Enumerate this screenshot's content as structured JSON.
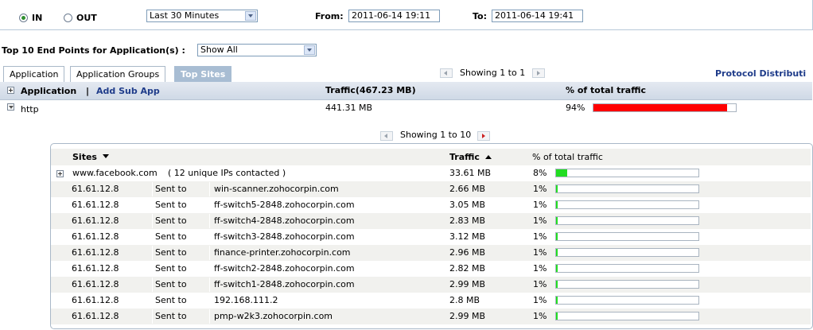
{
  "direction": {
    "in_label": "IN",
    "out_label": "OUT",
    "selected": "IN"
  },
  "range_select": "Last 30 Minutes",
  "from_label": "From:",
  "from_value": "2011-06-14 19:11",
  "to_label": "To:",
  "to_value": "2011-06-14 19:41",
  "endpoints_label": "Top 10 End Points for Application(s) :",
  "endpoints_select": "Show All",
  "tabs": [
    {
      "label": "Application",
      "active": false
    },
    {
      "label": "Application Groups",
      "active": false
    },
    {
      "label": "Top Sites",
      "active": true
    }
  ],
  "top_pager": "Showing 1 to 1",
  "protocol_link": "Protocol Distributi",
  "header": {
    "application": "Application",
    "separator": "|",
    "add_sub_app": "Add Sub App",
    "traffic": "Traffic(467.23 MB)",
    "percent": "% of total traffic"
  },
  "app_row": {
    "name": "http",
    "traffic": "441.31 MB",
    "percent_label": "94%",
    "percent": 94,
    "bar_color": "#ff0000"
  },
  "inner_pager": "Showing 1 to 10",
  "inner_header": {
    "sites": "Sites",
    "traffic": "Traffic",
    "percent": "% of total traffic"
  },
  "site": {
    "name": "www.facebook.com",
    "note": "( 12 unique IPs contacted )",
    "traffic": "33.61 MB",
    "percent_label": "8%",
    "percent": 8,
    "bar_color": "#22dd22"
  },
  "rows": [
    {
      "ip": "61.61.12.8",
      "action": "Sent to",
      "host": "win-scanner.zohocorpin.com",
      "traffic": "2.66 MB",
      "percent_label": "1%",
      "percent": 1
    },
    {
      "ip": "61.61.12.8",
      "action": "Sent to",
      "host": "ff-switch5-2848.zohocorpin.com",
      "traffic": "3.05 MB",
      "percent_label": "1%",
      "percent": 1
    },
    {
      "ip": "61.61.12.8",
      "action": "Sent to",
      "host": "ff-switch4-2848.zohocorpin.com",
      "traffic": "2.83 MB",
      "percent_label": "1%",
      "percent": 1
    },
    {
      "ip": "61.61.12.8",
      "action": "Sent to",
      "host": "ff-switch3-2848.zohocorpin.com",
      "traffic": "3.12 MB",
      "percent_label": "1%",
      "percent": 1
    },
    {
      "ip": "61.61.12.8",
      "action": "Sent to",
      "host": "finance-printer.zohocorpin.com",
      "traffic": "2.96 MB",
      "percent_label": "1%",
      "percent": 1
    },
    {
      "ip": "61.61.12.8",
      "action": "Sent to",
      "host": "ff-switch2-2848.zohocorpin.com",
      "traffic": "2.82 MB",
      "percent_label": "1%",
      "percent": 1
    },
    {
      "ip": "61.61.12.8",
      "action": "Sent to",
      "host": "ff-switch1-2848.zohocorpin.com",
      "traffic": "2.99 MB",
      "percent_label": "1%",
      "percent": 1
    },
    {
      "ip": "61.61.12.8",
      "action": "Sent to",
      "host": "192.168.111.2",
      "traffic": "2.8 MB",
      "percent_label": "1%",
      "percent": 1
    },
    {
      "ip": "61.61.12.8",
      "action": "Sent to",
      "host": "pmp-w2k3.zohocorpin.com",
      "traffic": "2.99 MB",
      "percent_label": "1%",
      "percent": 1
    }
  ]
}
